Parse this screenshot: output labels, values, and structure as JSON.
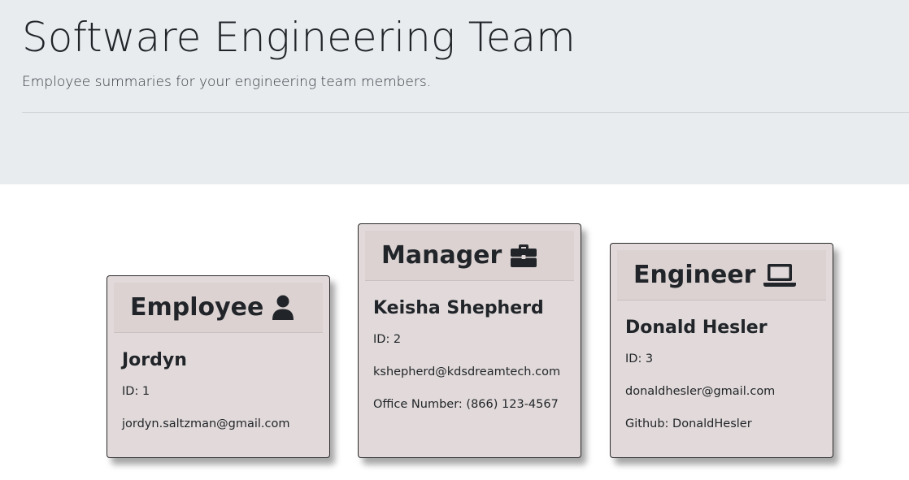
{
  "header": {
    "title": "Software Engineering Team",
    "subtitle": "Employee summaries for your engineering team members."
  },
  "cards": [
    {
      "role": "Employee",
      "icon": "user-icon",
      "name": "Jordyn",
      "id_text": "ID: 1",
      "email": "jordyn.saltzman@gmail.com",
      "extra": ""
    },
    {
      "role": "Manager",
      "icon": "briefcase-icon",
      "name": "Keisha Shepherd",
      "id_text": "ID: 2",
      "email": "kshepherd@kdsdreamtech.com",
      "extra": "Office Number: (866) 123-4567"
    },
    {
      "role": "Engineer",
      "icon": "laptop-icon",
      "name": "Donald Hesler",
      "id_text": "ID: 3",
      "email": "donaldhesler@gmail.com",
      "extra": "Github: DonaldHesler"
    }
  ]
}
